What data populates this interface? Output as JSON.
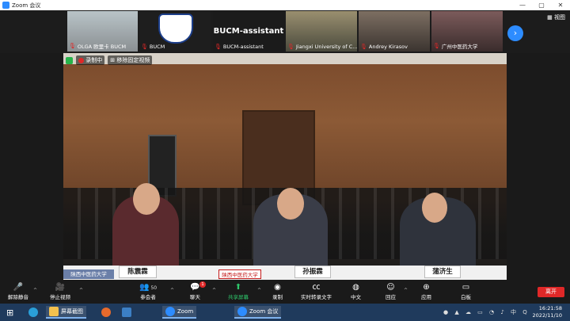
{
  "window": {
    "title": "Zoom 会议",
    "controls": [
      "—",
      "▢",
      "✕"
    ]
  },
  "view_label": "视图",
  "participants_strip": [
    {
      "name": "OLGA 欧里卡 BUCM"
    },
    {
      "name": "BUCM"
    },
    {
      "name": "BUCM-assistant",
      "big_name": "BUCM-assistant"
    },
    {
      "name": "Jiangxi University of C..."
    },
    {
      "name": "Andrey Kirasov"
    },
    {
      "name": "广州中医药大学"
    }
  ],
  "main_video": {
    "recording_label": "录制中",
    "unpin_label": "移除固定视频",
    "nameplates": [
      "陈震霖",
      "孙振霖",
      "蒲济生"
    ],
    "school_labels": [
      "陕西中医药大学",
      "陕西中医药大学"
    ]
  },
  "toolbar": {
    "unmute": "解除静音",
    "stop_video": "停止视频",
    "participants": "参会者",
    "participants_count": "50",
    "chat": "聊天",
    "chat_badge": "1",
    "share": "共享屏幕",
    "record": "录制",
    "captions": "实时转录文字",
    "language": "中文",
    "reactions": "回应",
    "apps": "应用",
    "whiteboard": "白板",
    "leave": "离开"
  },
  "taskbar": {
    "items": [
      "屏幕截图",
      "Zoom",
      "Zoom 会议"
    ],
    "time": "16:21:58",
    "date": "2022/11/10",
    "ime": "中"
  },
  "colors": {
    "accent": "#2d8cff",
    "leave": "#e02828",
    "share": "#2ec76b",
    "taskbar": "#1f3a5c"
  }
}
